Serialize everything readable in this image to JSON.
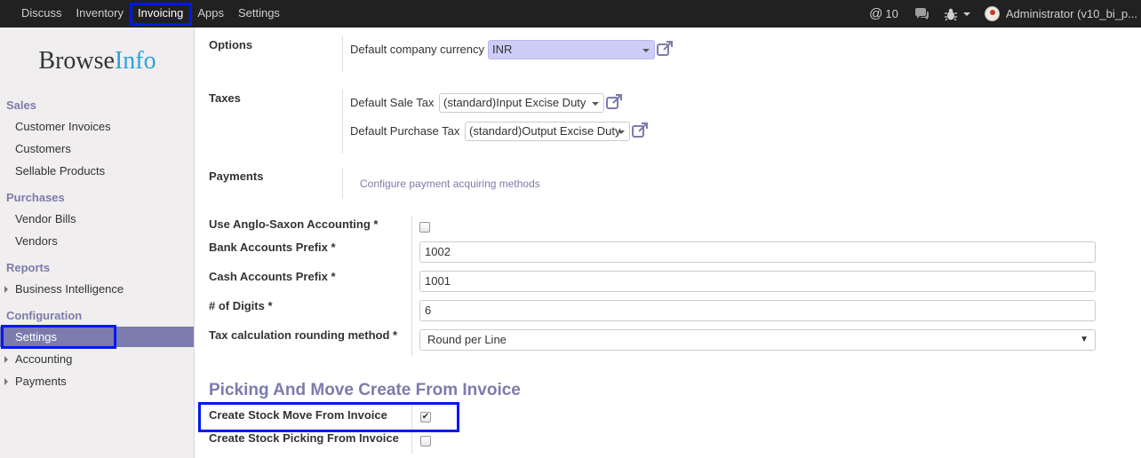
{
  "topbar": {
    "nav": [
      "Discuss",
      "Inventory",
      "Invoicing",
      "Apps",
      "Settings"
    ],
    "active": "Invoicing",
    "mentions_count": "10",
    "user": "Administrator (v10_bi_p..."
  },
  "brand": {
    "part1": "Browse",
    "part2": "Info"
  },
  "sidebar": {
    "sales_title": "Sales",
    "sales_items": [
      "Customer Invoices",
      "Customers",
      "Sellable Products"
    ],
    "purchases_title": "Purchases",
    "purchases_items": [
      "Vendor Bills",
      "Vendors"
    ],
    "reports_title": "Reports",
    "reports_items": [
      "Business Intelligence"
    ],
    "configuration_title": "Configuration",
    "configuration_items": [
      "Settings",
      "Accounting",
      "Payments"
    ]
  },
  "options": {
    "label": "Options",
    "currency_label": "Default company currency",
    "currency_value": "INR"
  },
  "taxes": {
    "label": "Taxes",
    "sale_label": "Default Sale Tax",
    "sale_value": "(standard)Input Excise Duty",
    "purchase_label": "Default Purchase Tax",
    "purchase_value": "(standard)Output Excise Duty"
  },
  "payments": {
    "label": "Payments",
    "link": "Configure payment acquiring methods"
  },
  "accounting": {
    "anglo_label": "Use Anglo-Saxon Accounting *",
    "anglo_checked": false,
    "bank_label": "Bank Accounts Prefix *",
    "bank_value": "1002",
    "cash_label": "Cash Accounts Prefix *",
    "cash_value": "1001",
    "digits_label": "# of Digits *",
    "digits_value": "6",
    "rounding_label": "Tax calculation rounding method *",
    "rounding_value": "Round per Line"
  },
  "picking": {
    "title": "Picking And Move Create From Invoice",
    "move_label": "Create Stock Move From Invoice",
    "move_checked": true,
    "picking_label": "Create Stock Picking From Invoice",
    "picking_checked": false
  },
  "colors": {
    "accent": "#7c7bad",
    "highlight": "#0018f0",
    "topbar": "#212121"
  }
}
